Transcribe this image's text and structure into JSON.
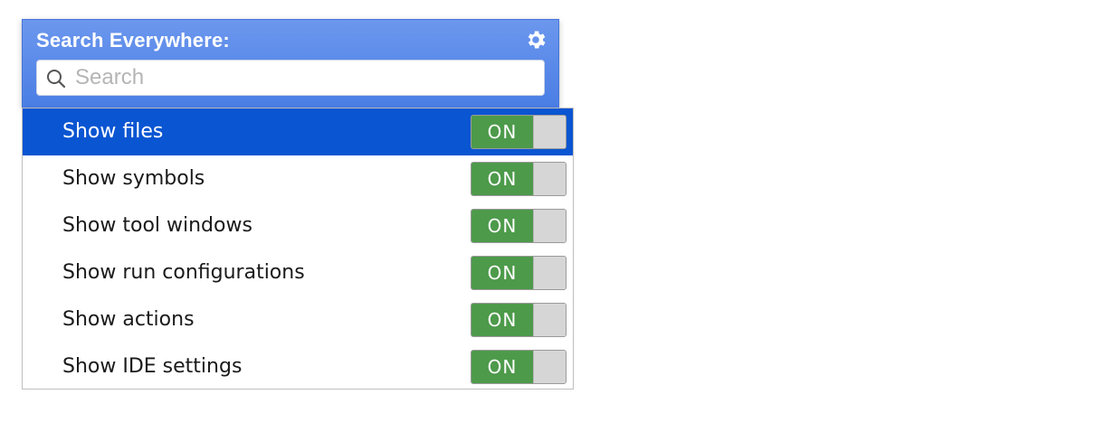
{
  "header": {
    "title": "Search Everywhere:",
    "settings_icon": "gear-icon"
  },
  "search": {
    "placeholder": "Search",
    "value": "",
    "icon": "search-icon"
  },
  "colors": {
    "header_bg": "#5b8cea",
    "selected_row": "#0a55d2",
    "toggle_on": "#4d9a4a"
  },
  "options": [
    {
      "label": "Show files",
      "state": "ON",
      "selected": true
    },
    {
      "label": "Show symbols",
      "state": "ON",
      "selected": false
    },
    {
      "label": "Show tool windows",
      "state": "ON",
      "selected": false
    },
    {
      "label": "Show run configurations",
      "state": "ON",
      "selected": false
    },
    {
      "label": "Show actions",
      "state": "ON",
      "selected": false
    },
    {
      "label": "Show IDE settings",
      "state": "ON",
      "selected": false
    }
  ]
}
